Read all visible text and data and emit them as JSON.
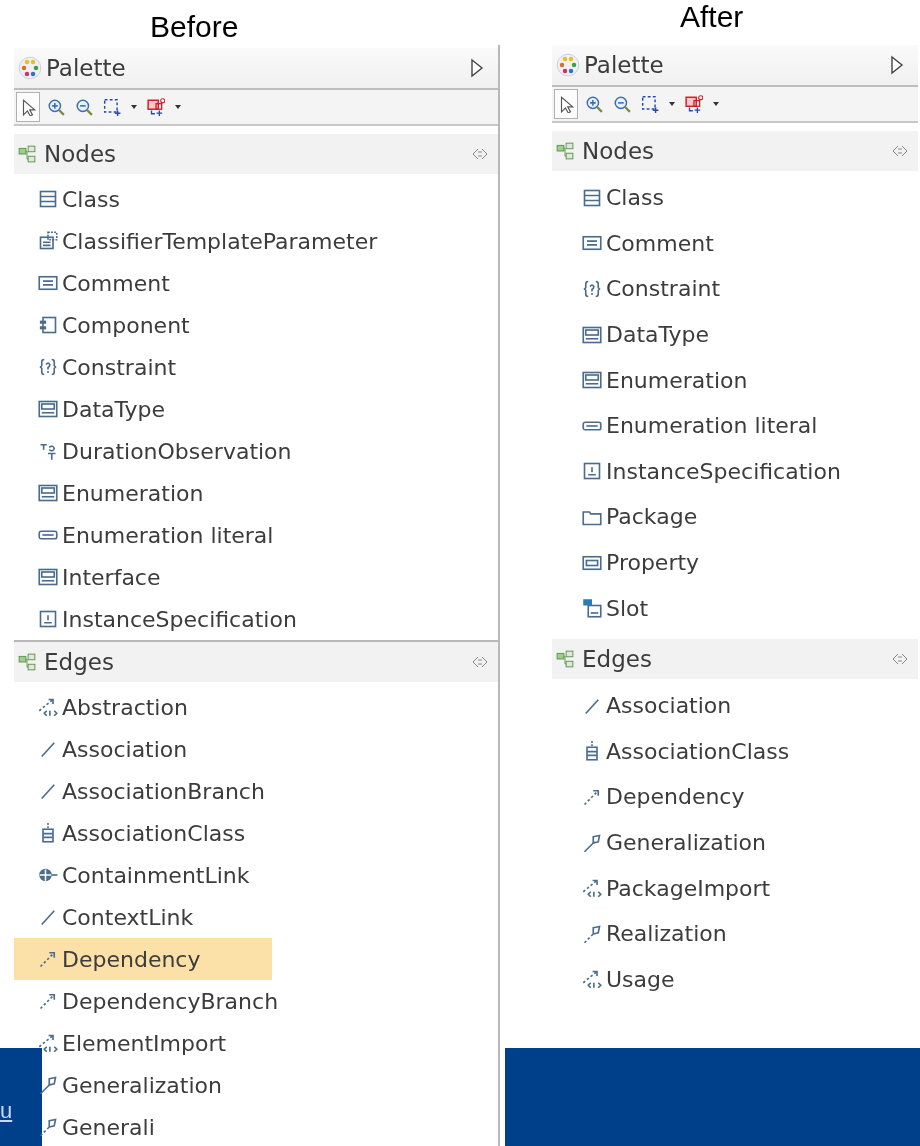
{
  "panels": [
    {
      "heading": "Before",
      "palette": {
        "title": "Palette",
        "tools": [
          {
            "kind": "pointer",
            "selected": true
          },
          {
            "kind": "zoom_in",
            "selected": false
          },
          {
            "kind": "zoom_out",
            "selected": false
          },
          {
            "kind": "marquee",
            "selected": false
          },
          {
            "kind": "dropdown",
            "selected": false
          },
          {
            "kind": "connection",
            "selected": false
          },
          {
            "kind": "dropdown",
            "selected": false
          }
        ]
      },
      "drawers": [
        {
          "title": "Nodes",
          "items": [
            {
              "label": "Class",
              "kind": "class",
              "selected": false
            },
            {
              "label": "ClassifierTemplateParameter",
              "kind": "template",
              "selected": false
            },
            {
              "label": "Comment",
              "kind": "comment",
              "selected": false
            },
            {
              "label": "Component",
              "kind": "component",
              "selected": false
            },
            {
              "label": "Constraint",
              "kind": "constraint",
              "selected": false
            },
            {
              "label": "DataType",
              "kind": "stereotype",
              "selected": false
            },
            {
              "label": "DurationObservation",
              "kind": "duration",
              "selected": false
            },
            {
              "label": "Enumeration",
              "kind": "stereotype",
              "selected": false
            },
            {
              "label": "Enumeration literal",
              "kind": "literal",
              "selected": false
            },
            {
              "label": "Interface",
              "kind": "stereotype",
              "selected": false
            },
            {
              "label": "InstanceSpecification",
              "kind": "instance",
              "selected": false
            }
          ]
        },
        {
          "title": "Edges",
          "items": [
            {
              "label": "Abstraction",
              "kind": "stereo_arrow",
              "selected": false
            },
            {
              "label": "Association",
              "kind": "line",
              "selected": false
            },
            {
              "label": "AssociationBranch",
              "kind": "line",
              "selected": false
            },
            {
              "label": "AssociationClass",
              "kind": "assoc_class",
              "selected": false
            },
            {
              "label": "ContainmentLink",
              "kind": "containment",
              "selected": false
            },
            {
              "label": "ContextLink",
              "kind": "line",
              "selected": false
            },
            {
              "label": "Dependency",
              "kind": "dashed_arrow",
              "selected": true
            },
            {
              "label": "DependencyBranch",
              "kind": "dashed_arrow",
              "selected": false
            },
            {
              "label": "ElementImport",
              "kind": "stereo_arrow",
              "selected": false
            },
            {
              "label": "Generalization",
              "kind": "generalization",
              "selected": false
            },
            {
              "label": "Generali",
              "kind": "realization",
              "selected": false
            }
          ]
        }
      ]
    },
    {
      "heading": "After",
      "palette": {
        "title": "Palette",
        "tools": [
          {
            "kind": "pointer",
            "selected": true
          },
          {
            "kind": "zoom_in",
            "selected": false
          },
          {
            "kind": "zoom_out",
            "selected": false
          },
          {
            "kind": "marquee",
            "selected": false
          },
          {
            "kind": "dropdown",
            "selected": false
          },
          {
            "kind": "connection",
            "selected": false
          },
          {
            "kind": "dropdown",
            "selected": false
          }
        ]
      },
      "drawers": [
        {
          "title": "Nodes",
          "items": [
            {
              "label": "Class",
              "kind": "class",
              "selected": false
            },
            {
              "label": "Comment",
              "kind": "comment",
              "selected": false
            },
            {
              "label": "Constraint",
              "kind": "constraint",
              "selected": false
            },
            {
              "label": "DataType",
              "kind": "stereotype",
              "selected": false
            },
            {
              "label": "Enumeration",
              "kind": "stereotype",
              "selected": false
            },
            {
              "label": "Enumeration literal",
              "kind": "literal",
              "selected": false
            },
            {
              "label": "InstanceSpecification",
              "kind": "instance",
              "selected": false
            },
            {
              "label": "Package",
              "kind": "package",
              "selected": false
            },
            {
              "label": "Property",
              "kind": "property",
              "selected": false
            },
            {
              "label": "Slot",
              "kind": "slot",
              "selected": false
            }
          ]
        },
        {
          "title": "Edges",
          "items": [
            {
              "label": "Association",
              "kind": "line",
              "selected": false
            },
            {
              "label": "AssociationClass",
              "kind": "assoc_class",
              "selected": false
            },
            {
              "label": "Dependency",
              "kind": "dashed_arrow",
              "selected": false
            },
            {
              "label": "Generalization",
              "kind": "generalization",
              "selected": false
            },
            {
              "label": "PackageImport",
              "kind": "stereo_arrow",
              "selected": false
            },
            {
              "label": "Realization",
              "kind": "realization",
              "selected": false
            },
            {
              "label": "Usage",
              "kind": "stereo_arrow",
              "selected": false
            }
          ]
        }
      ]
    }
  ],
  "background_link": {
    "text": "u"
  }
}
